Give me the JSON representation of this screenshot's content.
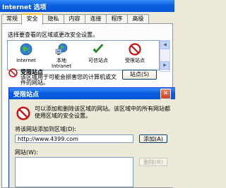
{
  "io_window": {
    "title": "Internet 选项",
    "tabs": [
      {
        "label": "常规",
        "active": false
      },
      {
        "label": "安全",
        "active": true
      },
      {
        "label": "隐私",
        "active": false
      },
      {
        "label": "内容",
        "active": false
      },
      {
        "label": "连接",
        "active": false
      },
      {
        "label": "程序",
        "active": false
      },
      {
        "label": "高级",
        "active": false
      }
    ],
    "zone_prompt": "选择要查看的区域或更改安全设置。",
    "zones": [
      {
        "label": "Internet",
        "icon": "globe-icon"
      },
      {
        "label": "本地\nIntranet",
        "icon": "intranet-icon"
      },
      {
        "label": "可信站点",
        "icon": "checkmark-icon"
      },
      {
        "label": "受限站点",
        "icon": "restricted-icon"
      }
    ],
    "selected_zone": {
      "name": "受限站点",
      "description": "该区域用于可能会损害您的计算机或文件的网站。"
    },
    "sites_button": "站点(S)"
  },
  "restricted_dialog": {
    "title": "受限站点",
    "message": "可以添加和删除该区域的网站。该区域中的所有网站都使用区域的安全设置。",
    "add_label": "将该网站添加到区域(D):",
    "add_input_value": "http://www.4399.com",
    "add_button": "添加(A)",
    "sites_label": "网站(W):",
    "sites": [],
    "remove_button": "删除(R)",
    "close_glyph": "✕"
  },
  "colors": {
    "titlebar": "#0a5fe0",
    "restricted_red": "#cc1010",
    "trusted_green": "#2a9a2a"
  }
}
